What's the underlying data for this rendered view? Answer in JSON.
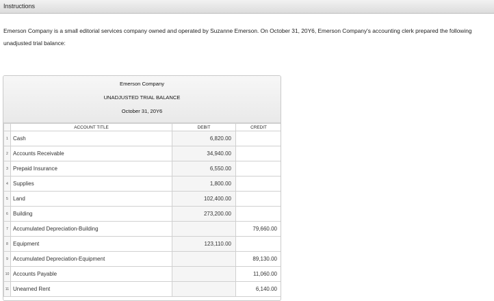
{
  "header": {
    "title": "Instructions"
  },
  "intro": "Emerson Company is a small editorial services company owned and operated by Suzanne Emerson. On October 31, 20Y6, Emerson Company's accounting clerk prepared the following unadjusted trial balance:",
  "trial_balance": {
    "company": "Emerson Company",
    "statement": "UNADJUSTED TRIAL BALANCE",
    "date": "October 31, 20Y6",
    "columns": {
      "account": "ACCOUNT TITLE",
      "debit": "DEBIT",
      "credit": "CREDIT"
    },
    "rows": [
      {
        "num": "1",
        "account": "Cash",
        "debit": "6,820.00",
        "credit": ""
      },
      {
        "num": "2",
        "account": "Accounts Receivable",
        "debit": "34,940.00",
        "credit": ""
      },
      {
        "num": "3",
        "account": "Prepaid Insurance",
        "debit": "6,550.00",
        "credit": ""
      },
      {
        "num": "4",
        "account": "Supplies",
        "debit": "1,800.00",
        "credit": ""
      },
      {
        "num": "5",
        "account": "Land",
        "debit": "102,400.00",
        "credit": ""
      },
      {
        "num": "6",
        "account": "Building",
        "debit": "273,200.00",
        "credit": ""
      },
      {
        "num": "7",
        "account": "Accumulated Depreciation-Building",
        "debit": "",
        "credit": "79,660.00"
      },
      {
        "num": "8",
        "account": "Equipment",
        "debit": "123,110.00",
        "credit": ""
      },
      {
        "num": "9",
        "account": "Accumulated Depreciation-Equipment",
        "debit": "",
        "credit": "89,130.00"
      },
      {
        "num": "10",
        "account": "Accounts Payable",
        "debit": "",
        "credit": "11,060.00"
      },
      {
        "num": "11",
        "account": "Unearned Rent",
        "debit": "",
        "credit": "6,140.00"
      }
    ]
  }
}
